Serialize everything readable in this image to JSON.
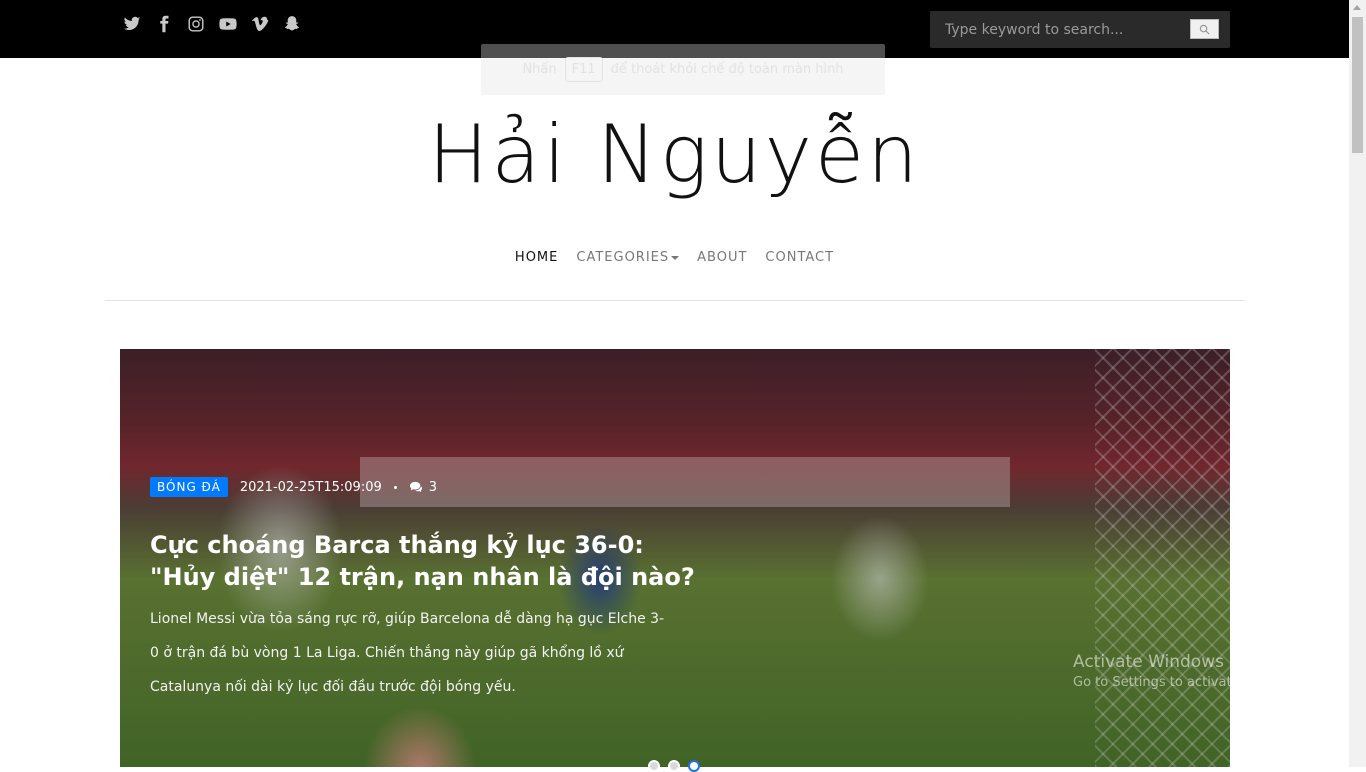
{
  "topbar": {
    "social_icons": [
      "twitter-icon",
      "facebook-icon",
      "instagram-icon",
      "youtube-icon",
      "vimeo-icon",
      "snapchat-icon"
    ],
    "search_placeholder": "Type keyword to search..."
  },
  "fullscreen_notice": {
    "before": "Nhấn",
    "key": "F11",
    "after": "để thoát khỏi chế độ toàn màn hình"
  },
  "site": {
    "title": "Hải Nguyễn"
  },
  "nav": {
    "home": "HOME",
    "categories": "CATEGORIES",
    "about": "ABOUT",
    "contact": "CONTACT"
  },
  "hero": {
    "category": "BÓNG ĐÁ",
    "date": "2021-02-25T15:09:09",
    "comments": "3",
    "title": "Cực choáng Barca thắng kỷ lục 36-0: \"Hủy diệt\" 12 trận, nạn nhân là đội nào?",
    "description": "Lionel Messi vừa tỏa sáng rực rỡ, giúp Barcelona dễ dàng hạ gục Elche 3-0 ở trận đá bù vòng 1 La Liga. Chiến thắng này giúp gã khổng lồ xứ Catalunya nối dài kỷ lục đối đầu trước đội bóng yếu.",
    "slides": 3,
    "active_slide": 3
  },
  "watermark": {
    "line1": "Activate Windows",
    "line2": "Go to Settings to activate Windows."
  },
  "colors": {
    "topbar": "#000000",
    "badge": "#007bff",
    "nav_active": "#111111",
    "nav": "#777777"
  }
}
